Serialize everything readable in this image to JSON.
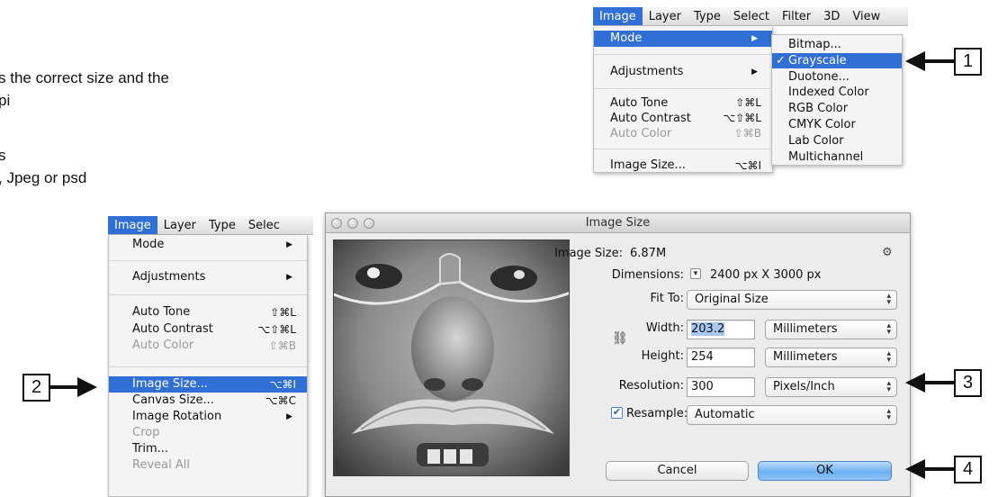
{
  "instructions": {
    "line1": "s the correct size and the",
    "line2": "pi",
    "line3": "s",
    "line4": ", Jpeg or psd"
  },
  "top_menu": {
    "bar_items": [
      "Image",
      "Layer",
      "Type",
      "Select",
      "Filter",
      "3D",
      "View"
    ],
    "items": {
      "mode": "Mode",
      "adjustments": "Adjustments",
      "auto_tone": "Auto Tone",
      "auto_tone_sc": "⇧⌘L",
      "auto_contrast": "Auto Contrast",
      "auto_contrast_sc": "⌥⇧⌘L",
      "auto_color": "Auto Color",
      "auto_color_sc": "⇧⌘B",
      "image_size": "Image Size...",
      "image_size_sc": "⌥⌘I"
    },
    "submenu": {
      "bitmap": "Bitmap...",
      "grayscale": "Grayscale",
      "check": "✓",
      "duotone": "Duotone...",
      "indexed": "Indexed Color",
      "rgb": "RGB Color",
      "cmyk": "CMYK Color",
      "lab": "Lab Color",
      "multichannel": "Multichannel"
    }
  },
  "left_menu": {
    "bar_items": [
      "Image",
      "Layer",
      "Type",
      "Selec"
    ],
    "items": {
      "mode": "Mode",
      "adjustments": "Adjustments",
      "auto_tone": "Auto Tone",
      "auto_tone_sc": "⇧⌘L",
      "auto_contrast": "Auto Contrast",
      "auto_contrast_sc": "⌥⇧⌘L",
      "auto_color": "Auto Color",
      "auto_color_sc": "⇧⌘B",
      "image_size": "Image Size...",
      "image_size_sc": "⌥⌘I",
      "canvas_size": "Canvas Size...",
      "canvas_size_sc": "⌥⌘C",
      "image_rotation": "Image Rotation",
      "crop": "Crop",
      "trim": "Trim...",
      "reveal_all": "Reveal All"
    }
  },
  "dialog": {
    "title": "Image Size",
    "image_size_label": "Image Size:",
    "image_size_value": "6.87M",
    "dimensions_label": "Dimensions:",
    "dimensions_value": "2400 px  X  3000 px",
    "fit_to_label": "Fit To:",
    "fit_to_value": "Original Size",
    "width_label": "Width:",
    "width_value": "203.2",
    "width_unit": "Millimeters",
    "height_label": "Height:",
    "height_value": "254",
    "height_unit": "Millimeters",
    "resolution_label": "Resolution:",
    "resolution_value": "300",
    "resolution_unit": "Pixels/Inch",
    "resample_label": "Resample:",
    "resample_checked": true,
    "resample_value": "Automatic",
    "cancel_label": "Cancel",
    "ok_label": "OK"
  },
  "callouts": [
    "1",
    "2",
    "3",
    "4"
  ],
  "icons": {
    "gear": "gear-icon",
    "link": "link-icon",
    "dropdown": "dropdown-toggle-icon",
    "updown": "up-down-arrows-icon",
    "arrow": "callout-arrow-icon"
  },
  "colors": {
    "menu_highlight": "#2f6fd6",
    "ok_button": "#6fb0f2"
  }
}
